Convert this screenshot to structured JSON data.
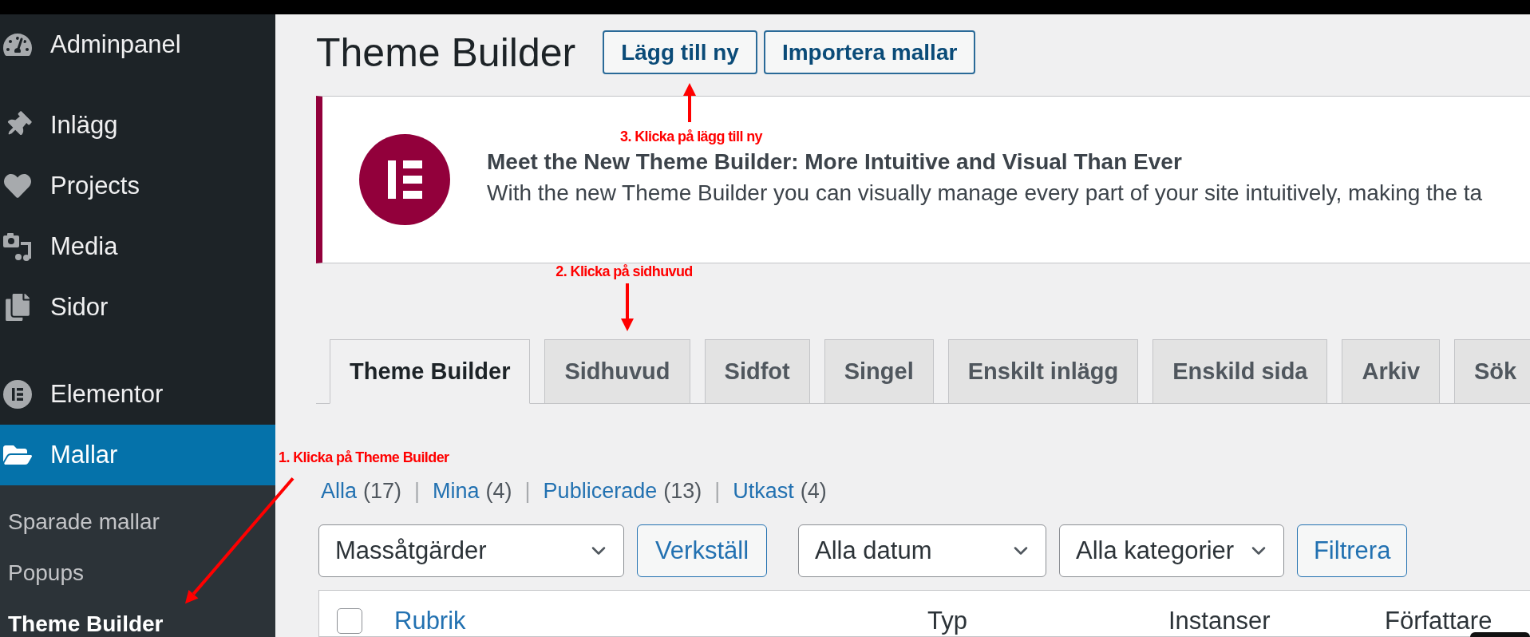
{
  "sidebar": {
    "groups": [
      {
        "items": [
          {
            "label": "Adminpanel",
            "selected": false
          }
        ]
      },
      {
        "items": [
          {
            "label": "Inlägg",
            "selected": false
          },
          {
            "label": "Projects",
            "selected": false
          },
          {
            "label": "Media",
            "selected": false
          },
          {
            "label": "Sidor",
            "selected": false
          }
        ]
      },
      {
        "items": [
          {
            "label": "Elementor",
            "selected": false
          },
          {
            "label": "Mallar",
            "selected": true,
            "children": [
              {
                "label": "Sparade mallar",
                "selected": false
              },
              {
                "label": "Popups",
                "selected": false
              },
              {
                "label": "Theme Builder",
                "selected": true
              }
            ]
          }
        ]
      }
    ]
  },
  "page": {
    "title": "Theme Builder",
    "actions": [
      "Lägg till ny",
      "Importera mallar"
    ]
  },
  "notice": {
    "heading": "Meet the New Theme Builder: More Intuitive and Visual Than Ever",
    "text": "With the new Theme Builder you can visually manage every part of your site intuitively, making the ta"
  },
  "tabs": [
    {
      "label": "Theme Builder",
      "selected": true
    },
    {
      "label": "Sidhuvud",
      "selected": false
    },
    {
      "label": "Sidfot",
      "selected": false
    },
    {
      "label": "Singel",
      "selected": false
    },
    {
      "label": "Enskilt inlägg",
      "selected": false
    },
    {
      "label": "Enskild sida",
      "selected": false
    },
    {
      "label": "Arkiv",
      "selected": false
    },
    {
      "label": "Sök",
      "selected": false
    }
  ],
  "views": [
    {
      "label": "Alla",
      "count": "(17)",
      "separator": "|"
    },
    {
      "label": "Mina",
      "count": "(4)",
      "separator": "|"
    },
    {
      "label": "Publicerade",
      "count": "(13)",
      "separator": "|"
    },
    {
      "label": "Utkast",
      "count": "(4)"
    }
  ],
  "bulk_actions": [
    {
      "kind": "select",
      "value": "Massåtgärder"
    },
    {
      "kind": "button",
      "label": "Verkställ"
    }
  ],
  "filters": [
    {
      "kind": "select",
      "value": "Alla datum"
    },
    {
      "kind": "select",
      "value": "Alla kategorier"
    },
    {
      "kind": "button",
      "label": "Filtrera"
    }
  ],
  "table": {
    "select_all": {
      "checked": false
    },
    "columns": [
      {
        "label": "Rubrik",
        "sortable": true
      },
      {
        "label": "Typ",
        "sortable": false
      },
      {
        "label": "Instanser",
        "sortable": false
      },
      {
        "label": "Författare",
        "sortable": false
      }
    ]
  },
  "annotations": [
    "1. Klicka på Theme Builder",
    "2. Klicka på sidhuvud",
    "3. Klicka på lägg till ny"
  ]
}
